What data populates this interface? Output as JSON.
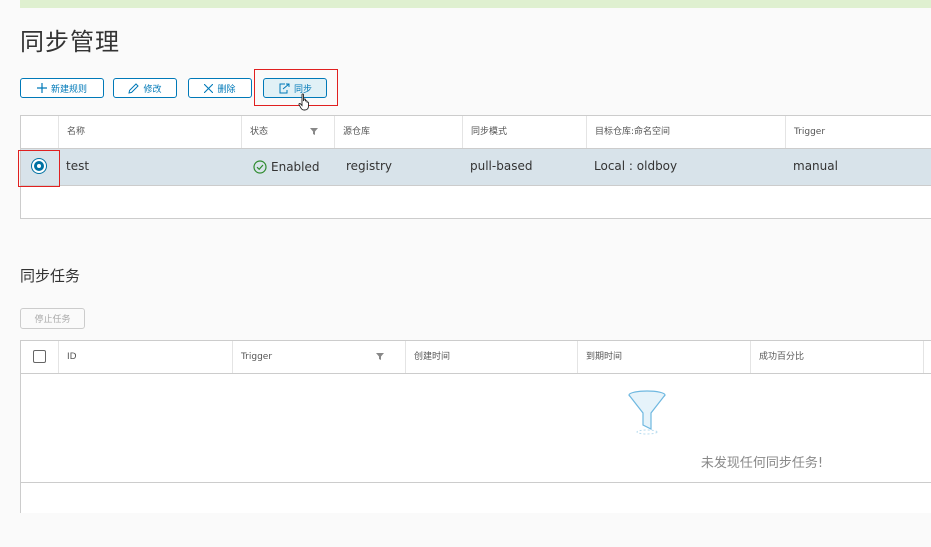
{
  "page": {
    "title": "同步管理"
  },
  "toolbar": {
    "new_rule": "新建规则",
    "edit": "修改",
    "delete": "删除",
    "sync": "同步"
  },
  "rules_table": {
    "headers": [
      "名称",
      "状态",
      "源仓库",
      "同步模式",
      "目标仓库:命名空间",
      "Trigger"
    ],
    "rows": [
      {
        "name": "test",
        "status": "Enabled",
        "source": "registry",
        "mode": "pull-based",
        "target": "Local : oldboy",
        "trigger": "manual"
      }
    ]
  },
  "tasks": {
    "title": "同步任务",
    "stop_button": "停止任务",
    "headers": [
      "ID",
      "Trigger",
      "创建时间",
      "到期时间",
      "成功百分比"
    ],
    "empty_message": "未发现任何同步任务!"
  },
  "colors": {
    "accent": "#0079b8",
    "selected_row": "#d8e3ea",
    "highlight": "#e02020",
    "success": "#2e8b2e"
  }
}
